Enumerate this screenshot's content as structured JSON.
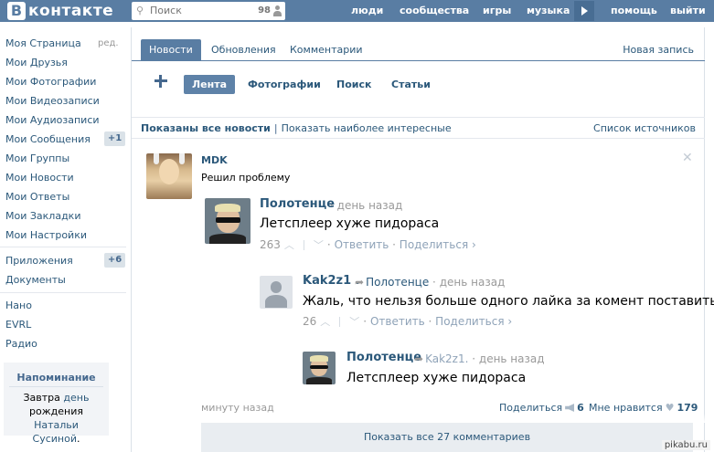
{
  "header": {
    "logo_letter": "В",
    "logo_text": "контакте",
    "search_placeholder": "Поиск",
    "search_count": "98",
    "nav": [
      "люди",
      "сообщества",
      "игры",
      "музыка",
      "помощь",
      "выйти"
    ]
  },
  "left_menu": {
    "items": [
      {
        "label": "Моя Страница",
        "extra": "ред."
      },
      {
        "label": "Мои Друзья"
      },
      {
        "label": "Мои Фотографии"
      },
      {
        "label": "Мои Видеозаписи"
      },
      {
        "label": "Мои Аудиозаписи"
      },
      {
        "label": "Мои Сообщения",
        "badge": "+1"
      },
      {
        "label": "Мои Группы"
      },
      {
        "label": "Мои Новости"
      },
      {
        "label": "Мои Ответы"
      },
      {
        "label": "Мои Закладки"
      },
      {
        "label": "Мои Настройки"
      }
    ],
    "items2": [
      {
        "label": "Приложения",
        "badge": "+6"
      },
      {
        "label": "Документы"
      }
    ],
    "items3": [
      {
        "label": "Нано"
      },
      {
        "label": "EVRL"
      },
      {
        "label": "Радио"
      }
    ],
    "reminder": {
      "title": "Напоминание",
      "text_1": "Завтра",
      "link_1": "день",
      "text_2": "рождения",
      "link_2": "Натальи Сусиной",
      "text_3": "."
    }
  },
  "tabs": {
    "items": [
      "Новости",
      "Обновления",
      "Комментарии"
    ],
    "right": "Новая запись"
  },
  "subtabs": [
    "Лента",
    "Фотографии",
    "Поиск",
    "Статьи"
  ],
  "filter": {
    "shown_all": "Показаны все новости",
    "separator": "|",
    "show_interesting": "Показать наиболее интересные",
    "sources": "Список источников"
  },
  "post": {
    "author": "MDK",
    "text": "Решил проблему",
    "comments": [
      {
        "author": "Полотенце",
        "sep": "·",
        "time": "день назад",
        "text": "Летсплеер хуже пидораса",
        "likes": "263",
        "reply": "Ответить",
        "share": "Поделиться"
      },
      {
        "author": "Kak2z1 .",
        "reply_to": "Полотенце",
        "sep": "·",
        "time": "день назад",
        "text": "Жаль, что нельзя больше одного лайка за комент поставить.",
        "likes": "26",
        "reply": "Ответить",
        "share": "Поделиться"
      },
      {
        "author": "Полотенце",
        "reply_to": "Kak2z1.",
        "sep": "·",
        "time": "день назад",
        "text": "Летсплеер хуже пидораса"
      }
    ],
    "footer": {
      "time": "минуту назад",
      "share_label": "Поделиться",
      "share_count": "6",
      "like_label": "Мне нравится",
      "like_count": "179"
    },
    "show_all_comments": "Показать все 27 комментариев"
  },
  "watermark": "pikabu.ru",
  "colors": {
    "header": "#597da3",
    "link": "#2b587a",
    "accent": "#45688e"
  }
}
